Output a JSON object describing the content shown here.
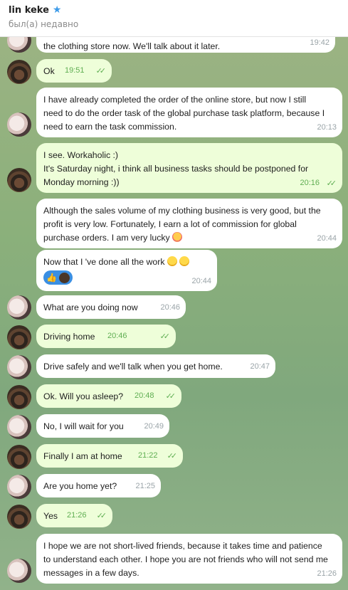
{
  "header": {
    "name": "lin keke",
    "status": "был(а) недавно"
  },
  "messages": [
    {
      "side": "in",
      "text": "the clothing store now. We'll talk about it later.",
      "time": "19:42"
    },
    {
      "side": "out",
      "text": "Ok",
      "time": "19:51"
    },
    {
      "side": "in",
      "text": "I have already completed the order of the online store, but now I still need to do the order task of the global purchase task platform, because I need to earn the task commission.",
      "time": "20:13"
    },
    {
      "side": "out",
      "text": "I see. Workaholic :)\nIt's Saturday night, i think all business tasks should be postponed for Monday morning :))",
      "time": "20:16"
    },
    {
      "side": "in",
      "text": "Although the sales volume of my clothing business is very good, but the profit is very low. Fortunately, I earn a lot of commission for global purchase orders. I am very lucky",
      "time": "20:44"
    },
    {
      "side": "in",
      "text": "Now that I 've done all the work",
      "time": "20:44"
    },
    {
      "side": "in",
      "text": "What are you doing now",
      "time": "20:46"
    },
    {
      "side": "out",
      "text": "Driving home",
      "time": "20:46"
    },
    {
      "side": "in",
      "text": "Drive safely and we'll talk when you get home.",
      "time": "20:47"
    },
    {
      "side": "out",
      "text": "Ok. Will you asleep?",
      "time": "20:48"
    },
    {
      "side": "in",
      "text": "No, I will wait for you",
      "time": "20:49"
    },
    {
      "side": "out",
      "text": "Finally I am at home",
      "time": "21:22"
    },
    {
      "side": "in",
      "text": "Are you home yet?",
      "time": "21:25"
    },
    {
      "side": "out",
      "text": "Yes",
      "time": "21:26"
    },
    {
      "side": "in",
      "text": "I hope we are not short-lived friends, because it takes time and patience to understand each other. I hope you are not friends who will not send me messages in a few days.",
      "time": "21:26"
    }
  ],
  "icons": {
    "verified": "star-icon",
    "read": "double-check-icon"
  },
  "colors": {
    "incoming": "#ffffff",
    "outgoing": "#eefed9",
    "accent": "#5fae52"
  }
}
